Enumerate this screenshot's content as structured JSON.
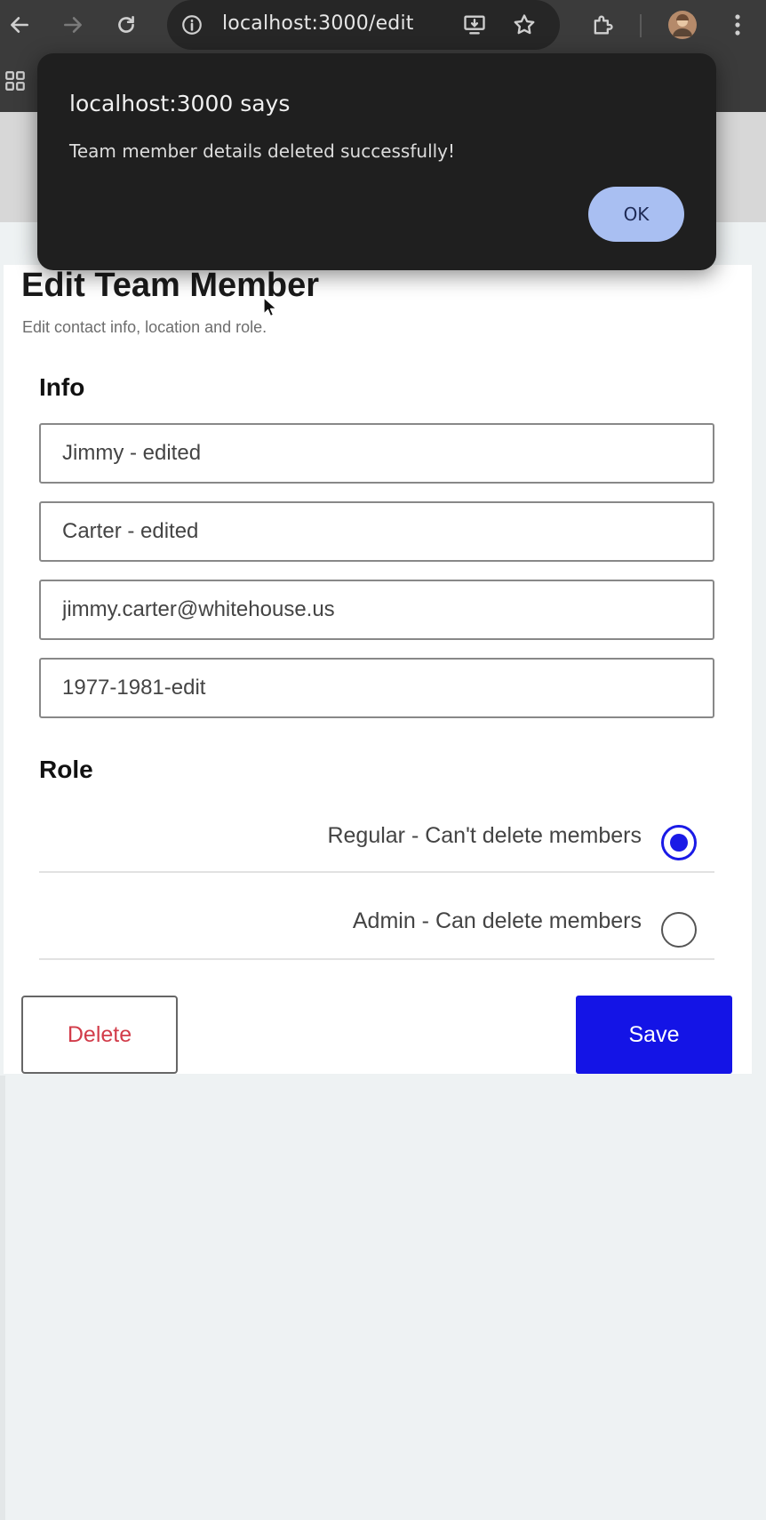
{
  "browser": {
    "url": "localhost:3000/edit",
    "icons": [
      "back-arrow-icon",
      "forward-arrow-icon",
      "reload-icon",
      "site-info-icon",
      "install-app-icon",
      "bookmark-star-icon",
      "extensions-icon",
      "profile-avatar",
      "menu-dots-icon",
      "apps-grid-icon"
    ]
  },
  "page": {
    "title": "Edit Team Member",
    "subtitle": "Edit contact info, location and role."
  },
  "info": {
    "label": "Info",
    "first_name": "Jimmy - edited",
    "last_name": "Carter - edited",
    "email": "jimmy.carter@whitehouse.us",
    "phone": "1977-1981-edit"
  },
  "role": {
    "label": "Role",
    "options": [
      {
        "label": "Regular - Can't delete members",
        "selected": true
      },
      {
        "label": "Admin - Can delete members",
        "selected": false
      }
    ]
  },
  "actions": {
    "delete_label": "Delete",
    "save_label": "Save"
  },
  "dialog": {
    "title": "localhost:3000 says",
    "message": "Team member details deleted successfully!",
    "ok_label": "OK"
  },
  "colors": {
    "accent": "#1414e6",
    "delete_text": "#d23c4a",
    "dialog_bg": "#1f1f1f",
    "ok_button": "#a9bff2"
  }
}
